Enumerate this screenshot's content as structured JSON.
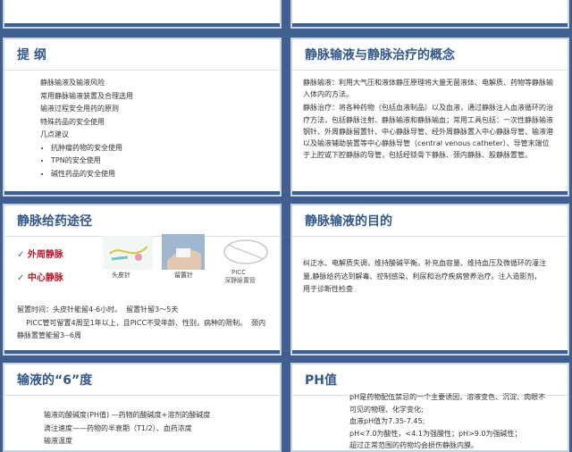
{
  "slides": {
    "s1": {
      "title": "提  纲",
      "lines": [
        "静脉输液及输液风险",
        "常用静脉输液装置及合理选用",
        "输液过程安全用药的原则",
        "特殊药品的安全使用",
        "几点建议"
      ],
      "bullets": [
        "抗肿瘤药物的安全使用",
        "TPN的安全使用",
        "碱性药品的安全使用"
      ]
    },
    "s2": {
      "title": "静脉输液与静脉治疗的概念",
      "p1": "静脉输液：利用大气压和液体静压原理将大量无菌液体、电解质、药物等静脉输入体内的方法。",
      "p2": "静脉治疗：将各种药物（包括血液制品）以及血液，通过静脉注入血液循环的治疗方法，包括静脉注射、静脉输液和静脉输血；常用工具包括：一次性静脉输液钢针、外周静脉留置针、中心静脉导管、经外周静脉置入中心静脉导管、输液港以及输液辅助装置等中心静脉导管（central venous catheter）、导管末端位于上腔或下腔静脉的导管，包括经锁骨下静脉、颈内静脉、股静脉置管。"
    },
    "s3": {
      "title": "静脉给药途径",
      "route1": "外周静脉",
      "route2": "中心静脉",
      "check": "✓",
      "img1": "头皮针",
      "img2": "留置针",
      "img3a": "PICC",
      "img3b": "深静脉置管",
      "text": "留置时间：头皮针能留4-6小时。  留置针留3～5天\n    PICC管可留置4周至1年以上，且PICC不受年龄、性别，病种的限制。  颈内静脉置管能留3--6周"
    },
    "s4": {
      "title": "静脉输液的目的",
      "text": "纠正水、电解质失调，维持酸碱平衡。补充血容量、维持血压及微循环的灌注量,静脉给药达到解毒、控制感染、利尿和治疗疾病营养治疗。注入造影剂，用于诊断性检查"
    },
    "s5": {
      "title": "输液的“6”度",
      "lines": [
        "输液的酸碱度(PH值) —药物的酸碱度+溶剂的酸碱度",
        "滴注速度——药物的半衰期（T1/2）、血药浓度",
        "输液温度"
      ]
    },
    "s6": {
      "title": "PH值",
      "lines": [
        "pH是药物配伍禁忌的一个主要诱因，溶液变色、沉淀、肉眼不可见的物理、化学变化;",
        "血液pH值为7.35-7.45;",
        "pH<7.0为酸性，<4.1为强酸性；pH>9.0为强碱性；",
        "超过正常范围的药物均会损伤静脉内膜。"
      ]
    }
  }
}
